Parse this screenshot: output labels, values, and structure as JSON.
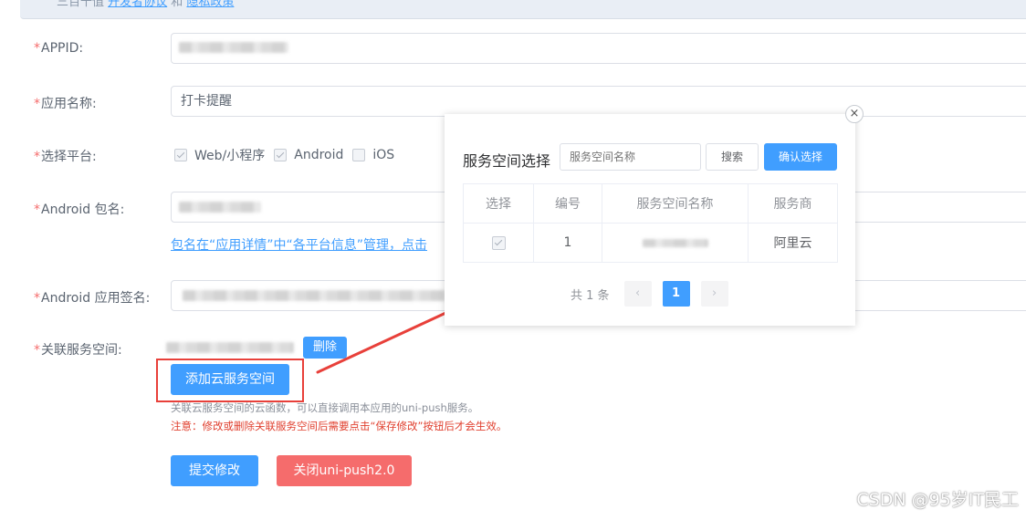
{
  "banner": {
    "text_prefix": "三百千值 ",
    "link1": "开发者协议",
    "middle": " 和 ",
    "link2": "隐私政策"
  },
  "form": {
    "appid": {
      "required": "*",
      "label": "APPID:"
    },
    "app_name": {
      "required": "*",
      "label": "应用名称:",
      "value": "打卡提醒"
    },
    "platform": {
      "required": "*",
      "label": "选择平台:",
      "options": [
        {
          "label": "Web/小程序",
          "checked": true
        },
        {
          "label": "Android",
          "checked": true
        },
        {
          "label": "iOS",
          "checked": false
        }
      ]
    },
    "android_package": {
      "required": "*",
      "label": "Android 包名:"
    },
    "package_hint": "包名在“应用详情”中“各平台信息”管理，点击",
    "android_signature": {
      "required": "*",
      "label": "Android 应用签名:"
    },
    "service_space": {
      "required": "*",
      "label": "关联服务空间:",
      "delete_label": "删除"
    },
    "add_cloud_button": "添加云服务空间",
    "note_gray": "关联云服务空间的云函数，可以直接调用本应用的uni-push服务。",
    "note_red": "注意：修改或删除关联服务空间后需要点击“保存修改”按钮后才会生效。",
    "submit_label": "提交修改",
    "close_push_label": "关闭uni-push2.0"
  },
  "modal": {
    "title": "服务空间选择",
    "search_placeholder": "服务空间名称",
    "search_label": "搜索",
    "confirm_label": "确认选择",
    "close_symbol": "×",
    "table": {
      "headers": [
        "选择",
        "编号",
        "服务空间名称",
        "服务商"
      ],
      "rows": [
        {
          "index": "1",
          "provider": "阿里云",
          "checked": true
        }
      ]
    },
    "pager": {
      "total": "共 1 条",
      "prev": "‹",
      "current": "1",
      "next": "›"
    }
  },
  "watermark": "CSDN @95岁IT民工",
  "colors": {
    "primary": "#409eff",
    "danger": "#f56c6c",
    "annotation_red": "#e8403a"
  }
}
